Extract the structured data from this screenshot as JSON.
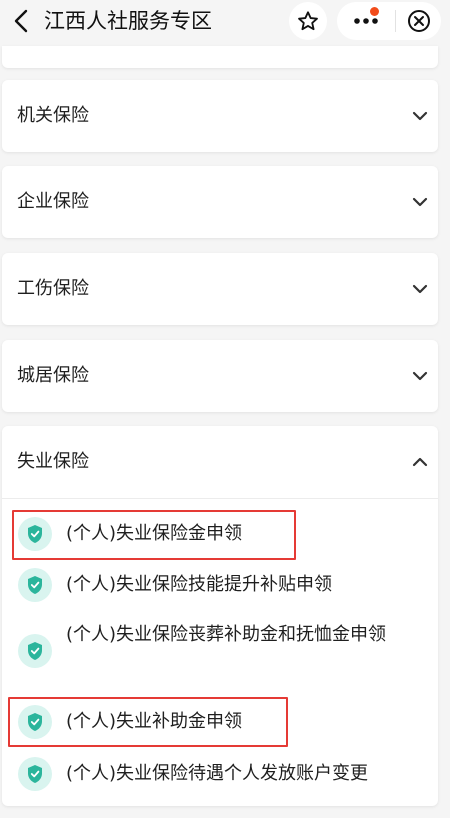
{
  "navbar": {
    "title": "江西人社服务专区",
    "back_icon": "chevron-left-icon",
    "favorite_icon": "star-icon",
    "more_icon": "more-dots-icon",
    "close_icon": "close-circle-icon",
    "notification_dot_color": "#f24c1b"
  },
  "categories": [
    {
      "label": "机关保险",
      "expanded": false
    },
    {
      "label": "企业保险",
      "expanded": false
    },
    {
      "label": "工伤保险",
      "expanded": false
    },
    {
      "label": "城居保险",
      "expanded": false
    },
    {
      "label": "失业保险",
      "expanded": true
    }
  ],
  "unemployment_services": [
    {
      "label": "(个人)失业保险金申领",
      "highlighted": true
    },
    {
      "label": "(个人)失业保险技能提升补贴申领",
      "highlighted": false
    },
    {
      "label": "(个人)失业保险丧葬补助金和抚恤金申领",
      "highlighted": false
    },
    {
      "label": "(个人)失业补助金申领",
      "highlighted": true
    },
    {
      "label": "(个人)失业保险待遇个人发放账户变更",
      "highlighted": false
    }
  ],
  "colors": {
    "icon_bg": "#d9f4ef",
    "icon_shield": "#2bb59c",
    "highlight_border": "#e53a35"
  }
}
